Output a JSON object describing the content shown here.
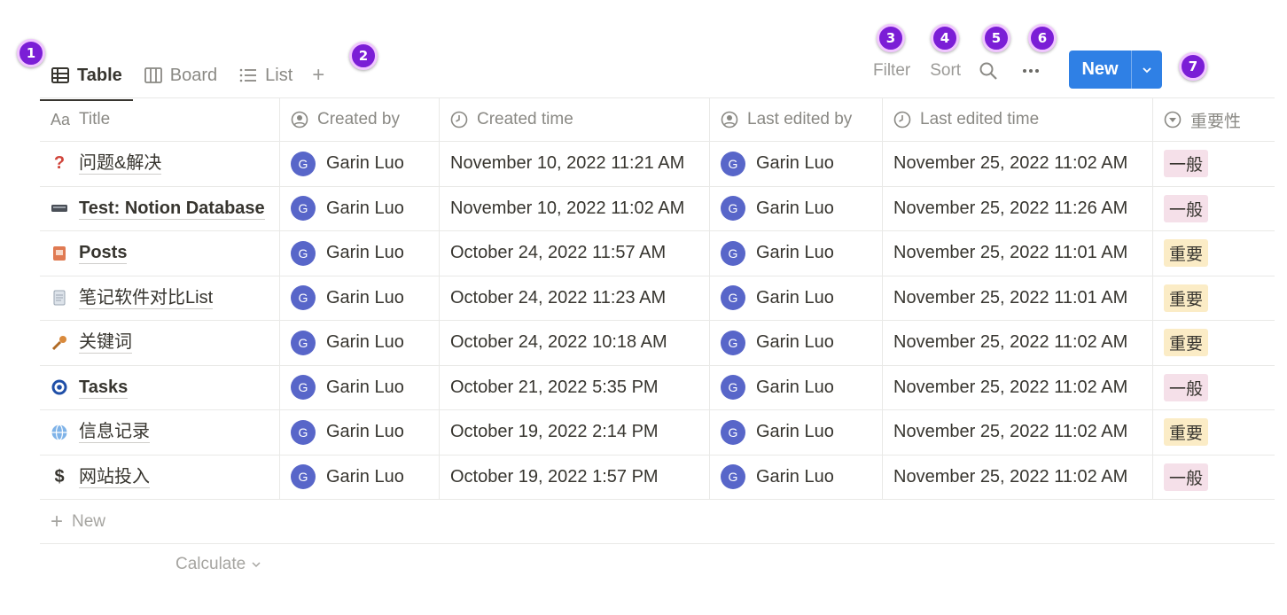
{
  "badges": [
    "1",
    "2",
    "3",
    "4",
    "5",
    "6",
    "7"
  ],
  "tabs": [
    {
      "label": "Table",
      "icon": "table-icon",
      "active": true
    },
    {
      "label": "Board",
      "icon": "board-icon",
      "active": false
    },
    {
      "label": "List",
      "icon": "list-icon",
      "active": false
    }
  ],
  "toolbar": {
    "filter": "Filter",
    "sort": "Sort",
    "new": "New"
  },
  "columns": {
    "title": "Title",
    "title_prefix": "Aa",
    "created_by": "Created by",
    "created_time": "Created time",
    "last_edited_by": "Last edited by",
    "last_edited_time": "Last edited time",
    "importance": "重要性"
  },
  "colors": {
    "accent": "#2f80e5",
    "tag_pink": "#f5e0e9",
    "tag_yellow": "#fbecc6",
    "avatar": "#5866c9",
    "badge": "#7b1ed6"
  },
  "rows": [
    {
      "icon": "question-icon",
      "title": "问题&解决",
      "created_by": "Garin Luo",
      "avatar": "G",
      "created_time": "November 10, 2022 11:21 AM",
      "last_edited_by": "Garin Luo",
      "last_edited_time": "November 25, 2022 11:02 AM",
      "importance": "一般"
    },
    {
      "icon": "keyboard-icon",
      "title": "Test: Notion Database",
      "created_by": "Garin Luo",
      "avatar": "G",
      "created_time": "November 10, 2022 11:02 AM",
      "last_edited_by": "Garin Luo",
      "last_edited_time": "November 25, 2022 11:26 AM",
      "importance": "一般"
    },
    {
      "icon": "notebook-icon",
      "title": "Posts",
      "created_by": "Garin Luo",
      "avatar": "G",
      "created_time": "October 24, 2022 11:57 AM",
      "last_edited_by": "Garin Luo",
      "last_edited_time": "November 25, 2022 11:01 AM",
      "importance": "重要"
    },
    {
      "icon": "memo-icon",
      "title": "笔记软件对比List",
      "created_by": "Garin Luo",
      "avatar": "G",
      "created_time": "October 24, 2022 11:23 AM",
      "last_edited_by": "Garin Luo",
      "last_edited_time": "November 25, 2022 11:01 AM",
      "importance": "重要"
    },
    {
      "icon": "key-icon",
      "title": "关键词",
      "created_by": "Garin Luo",
      "avatar": "G",
      "created_time": "October 24, 2022 10:18 AM",
      "last_edited_by": "Garin Luo",
      "last_edited_time": "November 25, 2022 11:02 AM",
      "importance": "重要"
    },
    {
      "icon": "target-icon",
      "title": "Tasks",
      "created_by": "Garin Luo",
      "avatar": "G",
      "created_time": "October 21, 2022 5:35 PM",
      "last_edited_by": "Garin Luo",
      "last_edited_time": "November 25, 2022 11:02 AM",
      "importance": "一般"
    },
    {
      "icon": "globe-icon",
      "title": "信息记录",
      "created_by": "Garin Luo",
      "avatar": "G",
      "created_time": "October 19, 2022 2:14 PM",
      "last_edited_by": "Garin Luo",
      "last_edited_time": "November 25, 2022 11:02 AM",
      "importance": "重要"
    },
    {
      "icon": "dollar-icon",
      "title": "网站投入",
      "created_by": "Garin Luo",
      "avatar": "G",
      "created_time": "October 19, 2022 1:57 PM",
      "last_edited_by": "Garin Luo",
      "last_edited_time": "November 25, 2022 11:02 AM",
      "importance": "一般"
    }
  ],
  "footer": {
    "new_row": "New",
    "calculate": "Calculate"
  }
}
